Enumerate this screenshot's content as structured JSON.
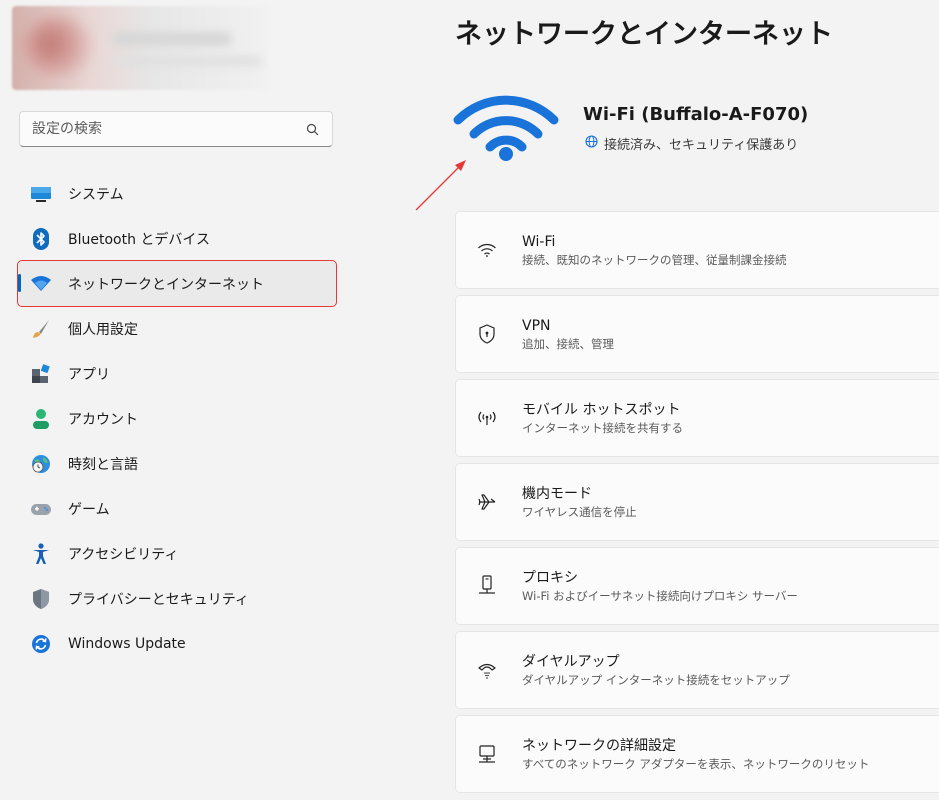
{
  "search": {
    "placeholder": "設定の検索"
  },
  "nav": [
    {
      "label": "システム",
      "icon": "system-display-icon"
    },
    {
      "label": "Bluetooth とデバイス",
      "icon": "bluetooth-icon"
    },
    {
      "label": "ネットワークとインターネット",
      "icon": "network-wifi-icon",
      "active": true
    },
    {
      "label": "個人用設定",
      "icon": "paintbrush-icon"
    },
    {
      "label": "アプリ",
      "icon": "apps-icon"
    },
    {
      "label": "アカウント",
      "icon": "account-icon"
    },
    {
      "label": "時刻と言語",
      "icon": "time-language-icon"
    },
    {
      "label": "ゲーム",
      "icon": "gamepad-icon"
    },
    {
      "label": "アクセシビリティ",
      "icon": "accessibility-icon"
    },
    {
      "label": "プライバシーとセキュリティ",
      "icon": "privacy-shield-icon"
    },
    {
      "label": "Windows Update",
      "icon": "windows-update-icon"
    }
  ],
  "main": {
    "title": "ネットワークとインターネット",
    "hero": {
      "name": "Wi-Fi (Buffalo-A-F070)",
      "status": "接続済み、セキュリティ保護あり",
      "icon": "wifi-large-icon",
      "status_icon": "globe-icon"
    },
    "cards": [
      {
        "title": "Wi-Fi",
        "sub": "接続、既知のネットワークの管理、従量制課金接続",
        "icon": "wifi-icon"
      },
      {
        "title": "VPN",
        "sub": "追加、接続、管理",
        "icon": "vpn-shield-icon"
      },
      {
        "title": "モバイル ホットスポット",
        "sub": "インターネット接続を共有する",
        "icon": "hotspot-icon"
      },
      {
        "title": "機内モード",
        "sub": "ワイヤレス通信を停止",
        "icon": "airplane-icon"
      },
      {
        "title": "プロキシ",
        "sub": "Wi-Fi およびイーサネット接続向けプロキシ サーバー",
        "icon": "proxy-icon"
      },
      {
        "title": "ダイヤルアップ",
        "sub": "ダイヤルアップ インターネット接続をセットアップ",
        "icon": "dialup-phone-icon"
      },
      {
        "title": "ネットワークの詳細設定",
        "sub": "すべてのネットワーク アダプターを表示、ネットワークのリセット",
        "icon": "network-pc-icon"
      }
    ]
  },
  "colors": {
    "accent": "#0067c0",
    "annotation": "#e53935",
    "wifi_blue": "#1a73d9"
  }
}
